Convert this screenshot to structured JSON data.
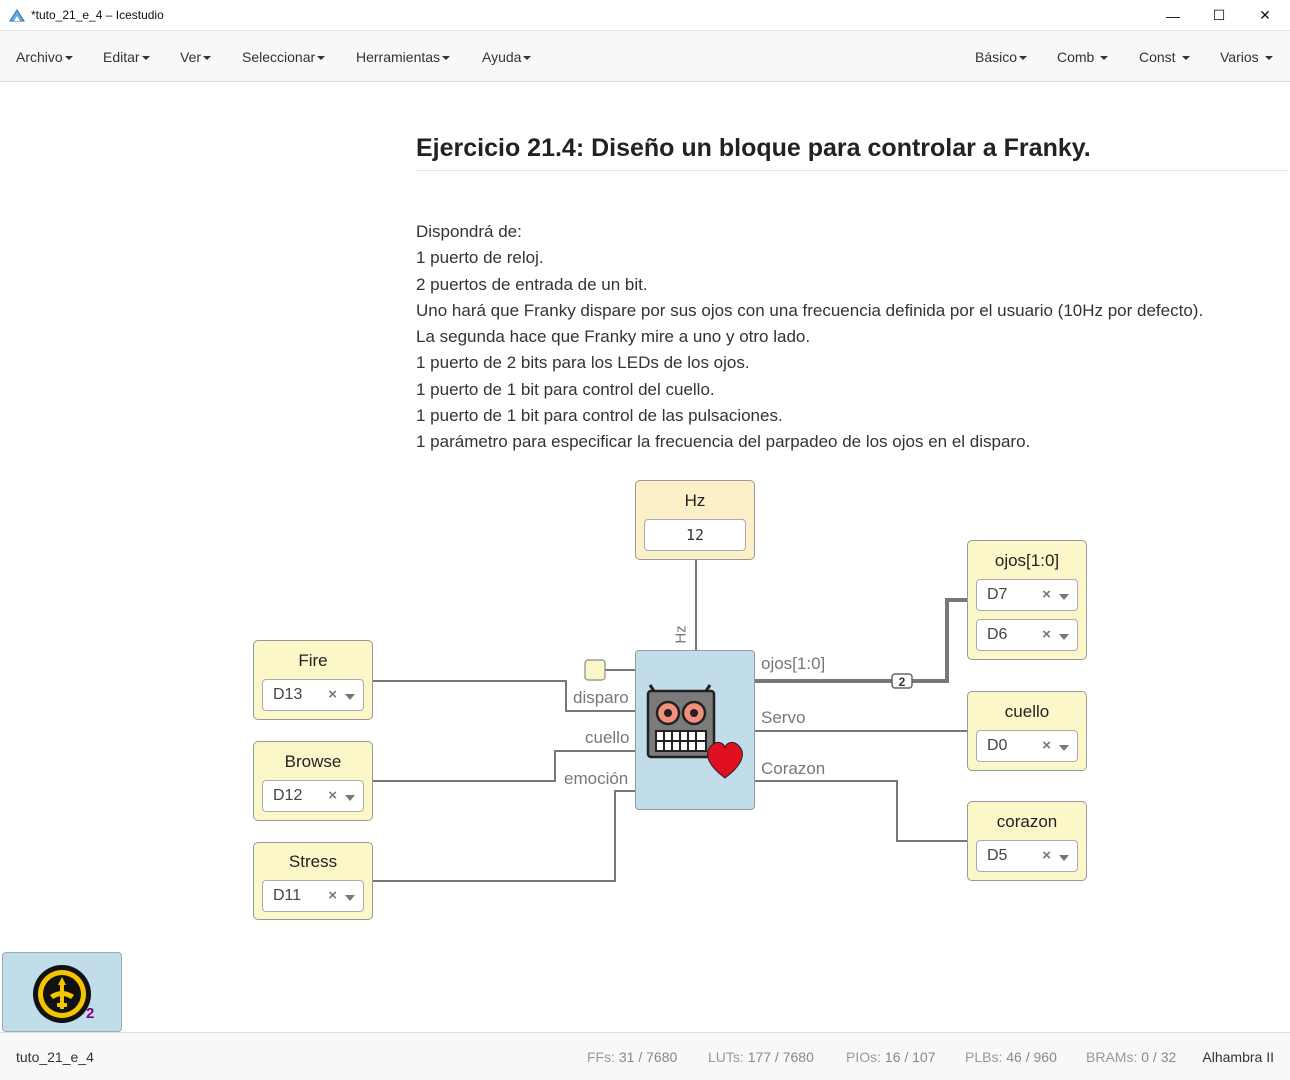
{
  "window": {
    "title": "*tuto_21_e_4 – Icestudio",
    "minimize": "—",
    "maximize": "☐",
    "close": "✕"
  },
  "menu": {
    "left": [
      "Archivo",
      "Editar",
      "Ver",
      "Seleccionar",
      "Herramientas",
      "Ayuda"
    ],
    "right": [
      "Básico",
      "Comb",
      "Const",
      "Varios"
    ]
  },
  "info": {
    "title": "Ejercicio 21.4: Diseño un bloque para controlar a Franky.",
    "lines": [
      "Dispondrá de:",
      "1 puerto de reloj.",
      "2 puertos de entrada de un bit.",
      "Uno hará que Franky dispare por sus ojos con una frecuencia definida por el usuario (10Hz por defecto).",
      "La segunda hace que Franky mire a uno y otro lado.",
      "1 puerto de 2 bits para los LEDs de los ojos.",
      "1 puerto de 1 bit para control del cuello.",
      "1 puerto de 1 bit para control de las pulsaciones.",
      "1 parámetro para especificar la frecuencia del parpadeo de los ojos en el disparo."
    ]
  },
  "constant": {
    "label": "Hz",
    "value": "12",
    "port_label": "Hz"
  },
  "inputs": [
    {
      "label": "Fire",
      "pin": "D13"
    },
    {
      "label": "Browse",
      "pin": "D12"
    },
    {
      "label": "Stress",
      "pin": "D11"
    }
  ],
  "outputs": {
    "ojos": {
      "label": "ojos[1:0]",
      "pins": [
        "D7",
        "D6"
      ]
    },
    "cuello": {
      "label": "cuello",
      "pin": "D0"
    },
    "corazon": {
      "label": "corazon",
      "pin": "D5"
    }
  },
  "franky_ports": {
    "inputs": [
      "disparo",
      "cuello",
      "emoción"
    ],
    "outputs": [
      "ojos[1:0]",
      "Servo",
      "Corazon"
    ],
    "bus_width": "2"
  },
  "pin_clear": "×",
  "collection_badge": "2",
  "status": {
    "file": "tuto_21_e_4",
    "ffs_label": "FFs:",
    "ffs": "31 / 7680",
    "luts_label": "LUTs:",
    "luts": "177 / 7680",
    "pios_label": "PIOs:",
    "pios": "16 / 107",
    "plbs_label": "PLBs:",
    "plbs": "46 / 960",
    "brams_label": "BRAMs:",
    "brams": "0 / 32",
    "board": "Alhambra II"
  },
  "colors": {
    "io_block": "#fcf7c9",
    "constant_block": "#fcf0c9",
    "code_block": "#c0dde9",
    "wire": "#777777",
    "heart": "#e01020"
  }
}
